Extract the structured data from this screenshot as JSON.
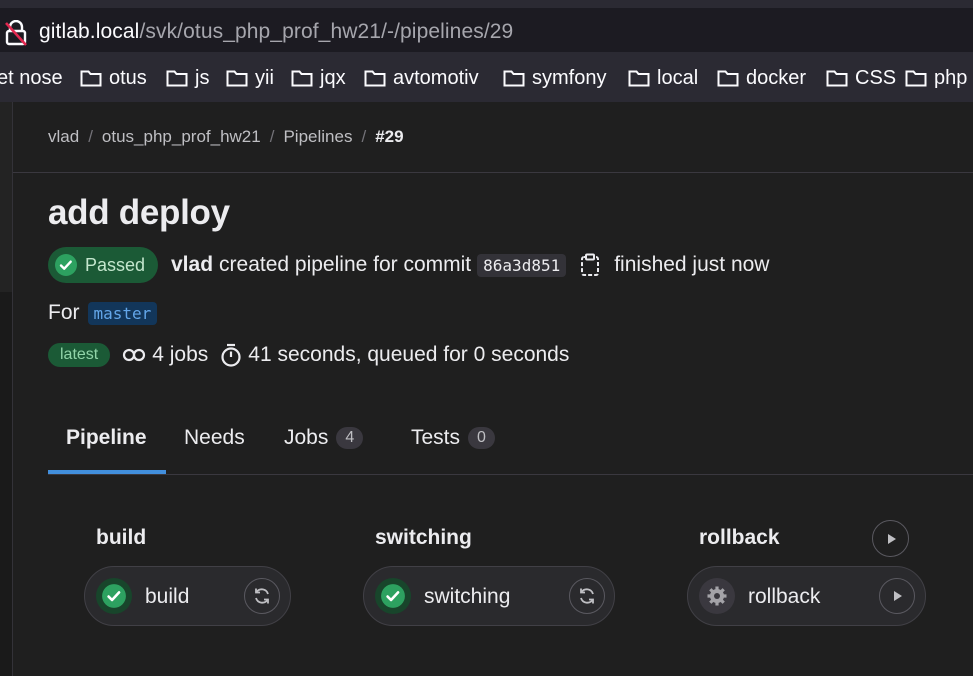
{
  "browser": {
    "url_host": "gitlab.local",
    "url_path": "/svk/otus_php_prof_hw21/-/pipelines/29",
    "bookmarks": [
      "et nose",
      "otus",
      "js",
      "yii",
      "jqx",
      "avtomotiv",
      "symfony",
      "local",
      "docker",
      "CSS",
      "php"
    ]
  },
  "breadcrumb": {
    "items": [
      "vlad",
      "otus_php_prof_hw21",
      "Pipelines"
    ],
    "current": "#29"
  },
  "pipeline": {
    "title": "add deploy",
    "status": "Passed",
    "author": "vlad",
    "created_text": "created pipeline for commit",
    "commit_sha": "86a3d851",
    "finished_text": "finished just now",
    "for_label": "For",
    "branch": "master",
    "latest_badge": "latest",
    "jobs_count_text": "4 jobs",
    "duration_text": "41 seconds, queued for 0 seconds"
  },
  "tabs": [
    {
      "label": "Pipeline",
      "active": true
    },
    {
      "label": "Needs"
    },
    {
      "label": "Jobs",
      "count": "4"
    },
    {
      "label": "Tests",
      "count": "0"
    }
  ],
  "stages": [
    {
      "title": "build",
      "job": "build",
      "status": "success",
      "action": "retry-icon"
    },
    {
      "title": "switching",
      "job": "switching",
      "status": "success",
      "action": "retry-icon"
    },
    {
      "title": "rollback",
      "job": "rollback",
      "status": "manual",
      "action": "play-icon"
    }
  ],
  "colors": {
    "success": "#2da160",
    "accent": "#428fdc",
    "branch": "#63a6e9",
    "background": "#1f1f1f"
  }
}
